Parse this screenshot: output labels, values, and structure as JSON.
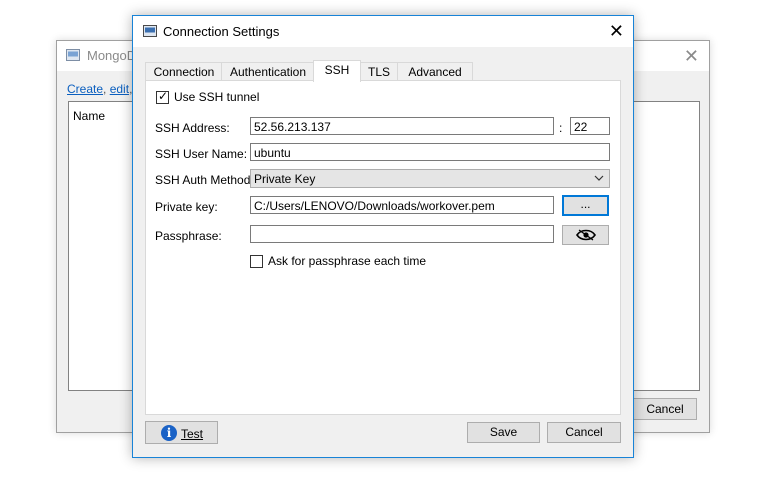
{
  "background_window": {
    "title": "MongoD",
    "links": {
      "create": "Create",
      "sep1": ", ",
      "edit": "edit",
      "sep2": ","
    },
    "list_header": "Name",
    "cancel_label": "Cancel"
  },
  "dialog": {
    "title": "Connection Settings",
    "close_label": "✕",
    "tabs": [
      {
        "label": "Connection"
      },
      {
        "label": "Authentication"
      },
      {
        "label": "SSH"
      },
      {
        "label": "TLS"
      },
      {
        "label": "Advanced"
      }
    ],
    "active_tab": "SSH",
    "ssh": {
      "use_tunnel_label": "Use SSH tunnel",
      "use_tunnel_checked": true,
      "address_label": "SSH Address:",
      "address_value": "52.56.213.137",
      "port_sep": ":",
      "port_value": "22",
      "user_label": "SSH User Name:",
      "user_value": "ubuntu",
      "auth_label": "SSH Auth Method:",
      "auth_value": "Private Key",
      "key_label": "Private key:",
      "key_value": "C:/Users/LENOVO/Downloads/workover.pem",
      "browse_label": "...",
      "passphrase_label": "Passphrase:",
      "passphrase_value": "",
      "ask_label": "Ask for passphrase each time",
      "ask_checked": false
    },
    "footer": {
      "test_label": "Test",
      "save_label": "Save",
      "cancel_label": "Cancel"
    }
  },
  "icons": {
    "title_icon": "app-window-icon",
    "info_icon": "info-icon",
    "eye_icon": "eye-icon",
    "dropdown_icon": "chevron-down-icon"
  },
  "colors": {
    "accent": "#0078d7",
    "link": "#0b5fbf",
    "info": "#1a62c6"
  }
}
